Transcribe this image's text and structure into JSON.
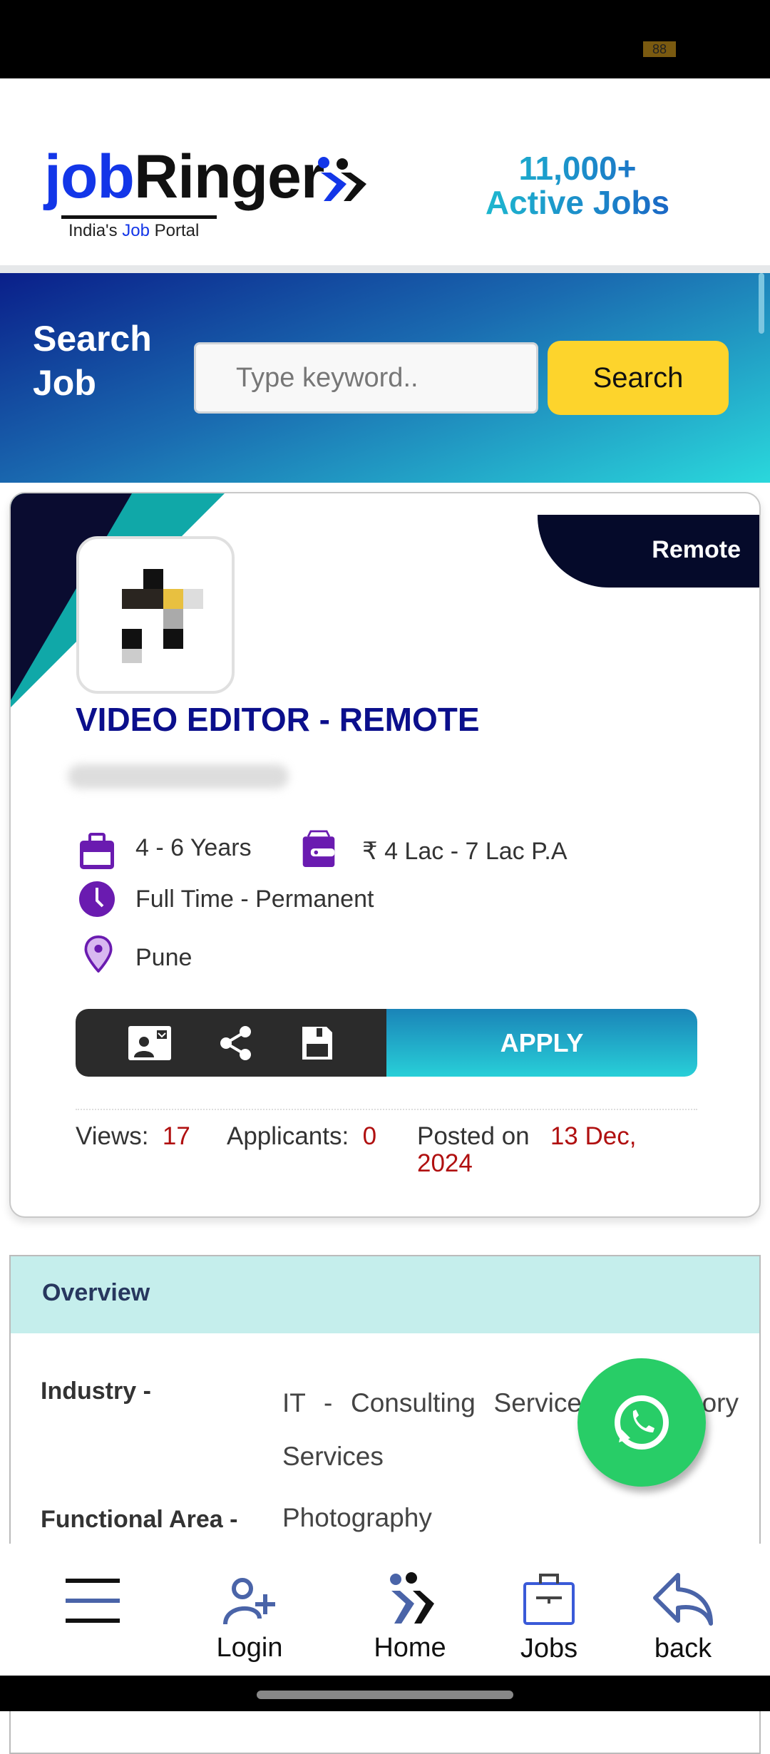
{
  "status_bar": {
    "battery": "88"
  },
  "header": {
    "logo_part1": "job",
    "logo_part2": "Ringer",
    "tagline_pre": "India's ",
    "tagline_job": "Job",
    "tagline_post": " Portal",
    "count": "11,000+",
    "count_label": "Active Jobs"
  },
  "search": {
    "title_line1": "Search",
    "title_line2": "Job",
    "placeholder": "Type keyword..",
    "value": "",
    "button": "Search"
  },
  "job": {
    "badge": "Remote",
    "title": "VIDEO EDITOR - REMOTE",
    "experience": "4 - 6 Years",
    "salary": "₹ 4 Lac - 7 Lac P.A",
    "job_type": "Full Time - Permanent",
    "location": "Pune",
    "apply": "APPLY",
    "views_label": "Views:",
    "views": "17",
    "applicants_label": "Applicants:",
    "applicants": "0",
    "posted_label": "Posted on",
    "posted_date": "13 Dec, 2024"
  },
  "overview": {
    "heading": "Overview",
    "rows": [
      {
        "label": "Industry -",
        "value": "IT - Consulting Services / Advisory Services"
      },
      {
        "label": "Functional Area -",
        "value": "Photography"
      }
    ]
  },
  "colors": {
    "brand_blue": "#1336e8",
    "accent_yellow": "#fdd42c",
    "icon_purple": "#6a1bb0",
    "whatsapp": "#28cd67",
    "date_red": "#b01010"
  },
  "bottom_nav": [
    {
      "label": "",
      "icon": "menu-icon"
    },
    {
      "label": "Login",
      "icon": "user-plus-icon"
    },
    {
      "label": "Home",
      "icon": "home-logo-icon"
    },
    {
      "label": "Jobs",
      "icon": "briefcase-icon"
    },
    {
      "label": "back",
      "icon": "back-arrow-icon"
    }
  ]
}
